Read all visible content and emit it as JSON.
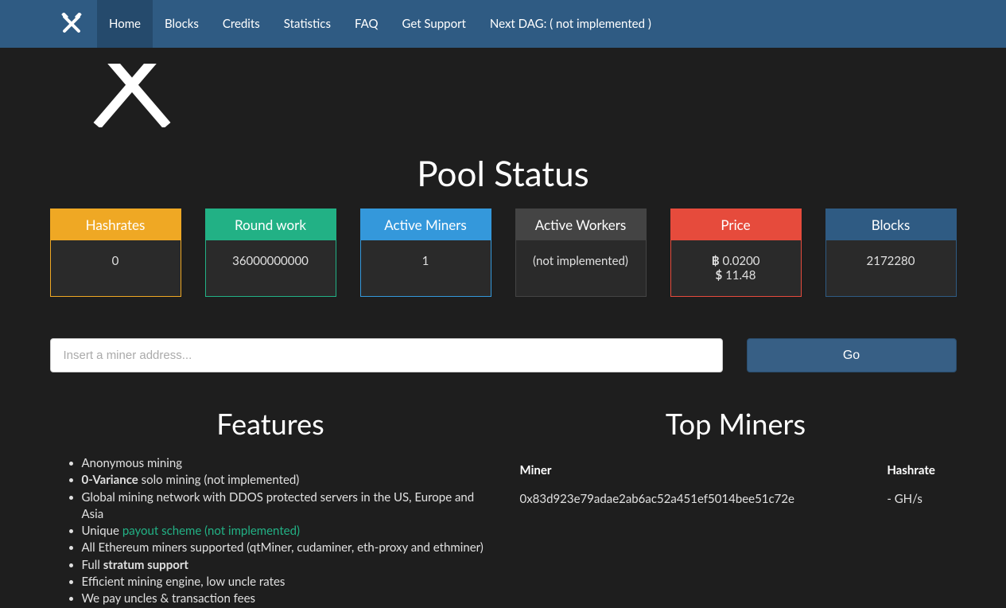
{
  "nav": {
    "items": [
      "Home",
      "Blocks",
      "Credits",
      "Statistics",
      "FAQ",
      "Get Support"
    ],
    "active_index": 0,
    "dag_text": "Next DAG: ( not implemented )"
  },
  "heading": "Pool Status",
  "stats": {
    "hashrates": {
      "label": "Hashrates",
      "value": "0"
    },
    "round_work": {
      "label": "Round work",
      "value": "36000000000"
    },
    "active_miners": {
      "label": "Active Miners",
      "value": "1"
    },
    "active_workers": {
      "label": "Active Workers",
      "value": "(not implemented)"
    },
    "price": {
      "label": "Price",
      "btc": "0.0200",
      "usd": "11.48"
    },
    "blocks": {
      "label": "Blocks",
      "value": "2172280"
    }
  },
  "search": {
    "placeholder": "Insert a miner address...",
    "button": "Go"
  },
  "features": {
    "heading": "Features",
    "f1": "Anonymous mining",
    "f2_strong": "0-Variance",
    "f2_rest": " solo mining (not implemented)",
    "f3": "Global mining network with DDOS protected servers in the US, Europe and Asia",
    "f4_pre": "Unique ",
    "f4_link": "payout scheme (not implemented)",
    "f5": "All Ethereum miners supported (qtMiner, cudaminer, eth-proxy and ethminer)",
    "f6_pre": "Full ",
    "f6_strong": "stratum support",
    "f7": "Efficient mining engine, low uncle rates",
    "f8": "We pay uncles & transaction fees"
  },
  "top_miners": {
    "heading": "Top Miners",
    "col_miner": "Miner",
    "col_hashrate": "Hashrate",
    "rows": [
      {
        "miner": "0x83d923e79adae2ab6ac52a451ef5014bee51c72e",
        "hashrate": "- GH/s"
      }
    ]
  }
}
